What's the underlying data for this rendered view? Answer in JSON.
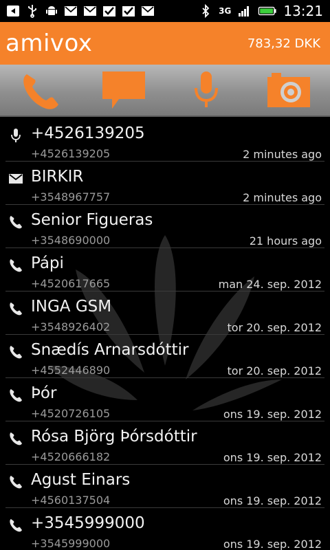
{
  "status_bar": {
    "time": "13:21",
    "network": "3G",
    "notification_icons": [
      "back-arrow-icon",
      "usb-icon",
      "android-icon",
      "mail-icon",
      "mail-icon",
      "check-icon",
      "check-icon",
      "mail-icon"
    ],
    "right_icons": [
      "bluetooth-icon",
      "signal-icon",
      "battery-icon"
    ]
  },
  "app": {
    "title": "amivox",
    "balance": "783,32 DKK"
  },
  "toolbar": {
    "buttons": [
      {
        "name": "call-button",
        "icon": "phone-icon"
      },
      {
        "name": "message-button",
        "icon": "speech-bubble-icon"
      },
      {
        "name": "voice-button",
        "icon": "microphone-icon"
      },
      {
        "name": "camera-button",
        "icon": "camera-icon"
      }
    ],
    "accent": "#F5822A"
  },
  "history": [
    {
      "type": "microphone-icon",
      "name": "+4526139205",
      "number": "+4526139205",
      "time": "2  minutes ago"
    },
    {
      "type": "mail-icon",
      "name": "BIRKIR",
      "number": "+3548967757",
      "time": "2  minutes ago"
    },
    {
      "type": "phone-icon",
      "name": "Senior Figueras",
      "number": "+3548690000",
      "time": "21 hours ago"
    },
    {
      "type": "phone-icon",
      "name": "Pápi",
      "number": "+4520617665",
      "time": "man 24. sep. 2012"
    },
    {
      "type": "phone-icon",
      "name": "INGA GSM",
      "number": "+3548926402",
      "time": "tor 20. sep. 2012"
    },
    {
      "type": "phone-icon",
      "name": "Snædís Arnarsdóttir",
      "number": "+4552446890",
      "time": "tor 20. sep. 2012"
    },
    {
      "type": "phone-icon",
      "name": "Þór",
      "number": "+4520726105",
      "time": "ons 19. sep. 2012"
    },
    {
      "type": "phone-icon",
      "name": "Rósa Björg Þórsdóttir",
      "number": "+4520666182",
      "time": "ons 19. sep. 2012"
    },
    {
      "type": "phone-icon",
      "name": "Agust Einars",
      "number": "+4560137504",
      "time": "ons 19. sep. 2012"
    },
    {
      "type": "phone-icon",
      "name": "+3545999000",
      "number": "+3545999000",
      "time": "ons 19. sep. 2012"
    }
  ]
}
